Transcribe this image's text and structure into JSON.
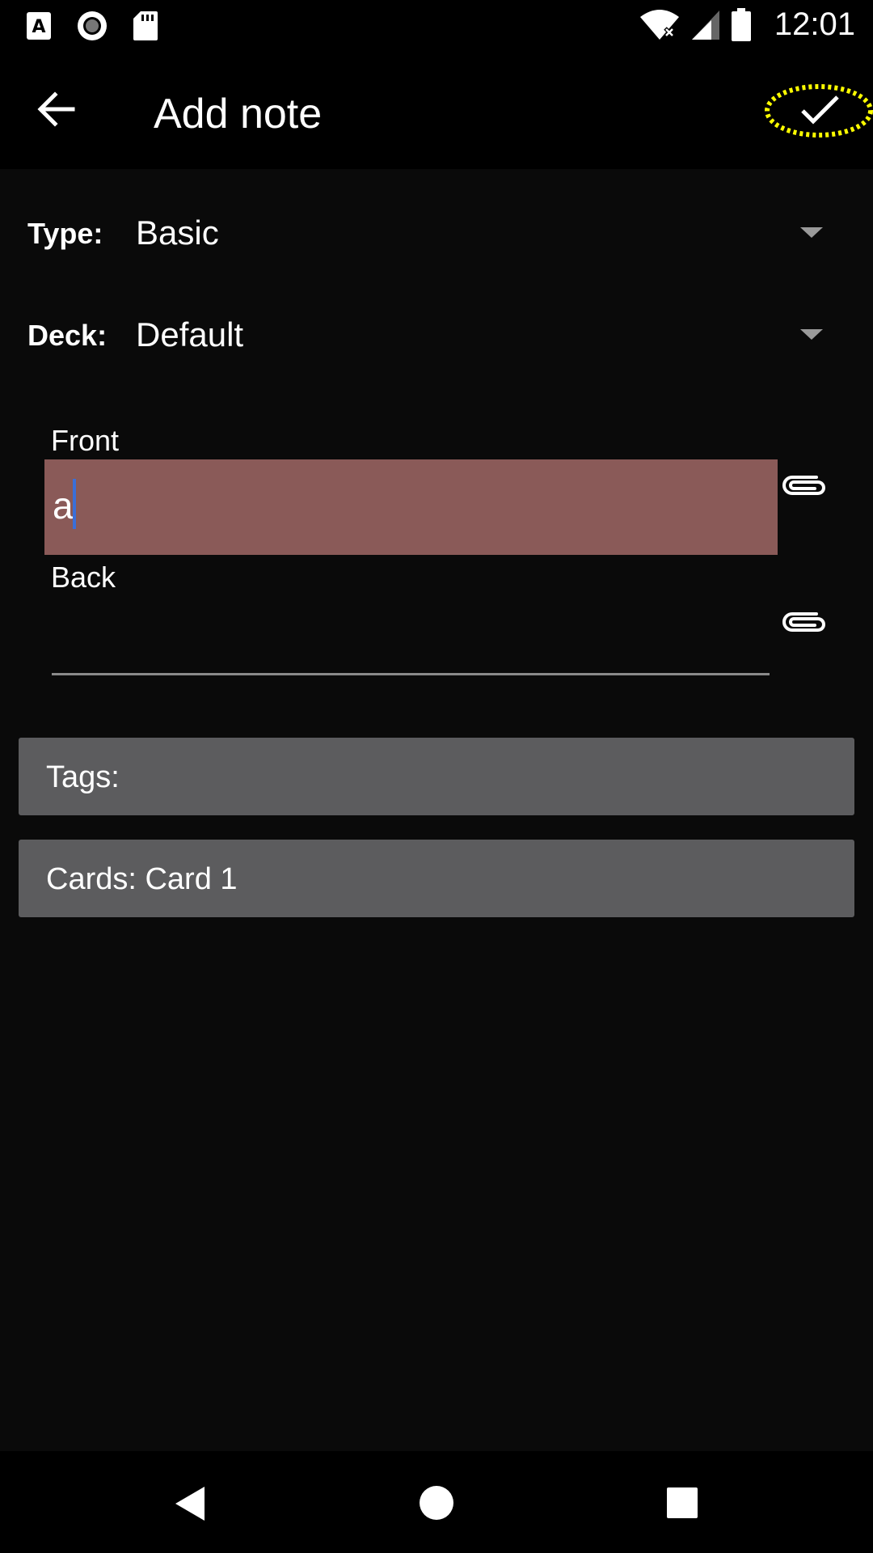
{
  "status_bar": {
    "time": "12:01",
    "icons": [
      "notification-a-icon",
      "circle-record-icon",
      "sd-card-icon",
      "wifi-icon",
      "cell-signal-icon",
      "battery-icon"
    ]
  },
  "app_bar": {
    "title": "Add note",
    "back_icon": "arrow-back-icon",
    "confirm_icon": "checkmark-icon"
  },
  "form": {
    "type_label": "Type:",
    "type_value": "Basic",
    "deck_label": "Deck:",
    "deck_value": "Default",
    "fields": [
      {
        "label": "Front",
        "value": "a"
      },
      {
        "label": "Back",
        "value": ""
      }
    ],
    "tags_label": "Tags:",
    "cards_label": "Cards: Card 1"
  },
  "colors": {
    "background": "#0a0a0a",
    "front_field_bg": "#8a5a58",
    "gray_box": "#5c5c5e",
    "caret": "#3a6fd8",
    "highlight": "#ffff00"
  },
  "nav_bar": {
    "icons": [
      "back-triangle-icon",
      "home-circle-icon",
      "recents-square-icon"
    ]
  }
}
